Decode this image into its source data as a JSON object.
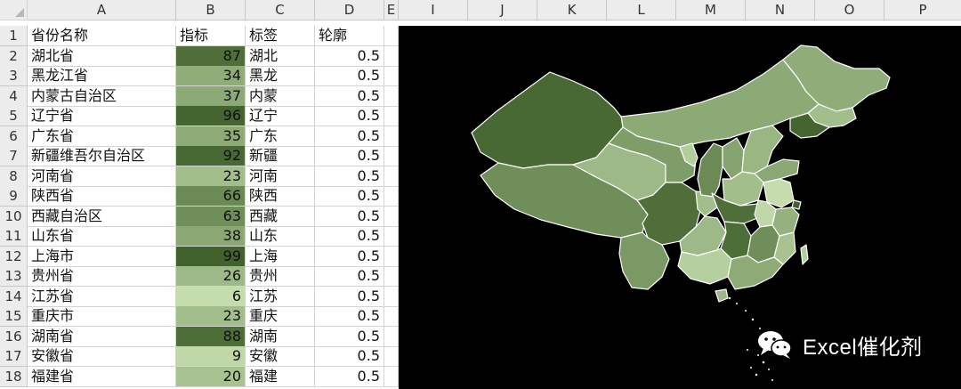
{
  "columns": {
    "row_header_corner": "",
    "letters": [
      "A",
      "B",
      "C",
      "D",
      "E",
      "I",
      "J",
      "K",
      "L",
      "M",
      "N",
      "O",
      "P"
    ]
  },
  "headers": {
    "province_name": "省份名称",
    "indicator": "指标",
    "label": "标签",
    "outline": "轮廓"
  },
  "rows": [
    {
      "num": "2",
      "name": "湖北省",
      "value": "87",
      "tag": "湖北",
      "outline": "0.5",
      "fill": "#4f6e3a"
    },
    {
      "num": "3",
      "name": "黑龙江省",
      "value": "34",
      "tag": "黑龙",
      "outline": "0.5",
      "fill": "#90ad79"
    },
    {
      "num": "4",
      "name": "内蒙古自治区",
      "value": "37",
      "tag": "内蒙",
      "outline": "0.5",
      "fill": "#8caa75"
    },
    {
      "num": "5",
      "name": "辽宁省",
      "value": "96",
      "tag": "辽宁",
      "outline": "0.5",
      "fill": "#446430"
    },
    {
      "num": "6",
      "name": "广东省",
      "value": "35",
      "tag": "广东",
      "outline": "0.5",
      "fill": "#8eab77"
    },
    {
      "num": "7",
      "name": "新疆维吾尔自治区",
      "value": "92",
      "tag": "新疆",
      "outline": "0.5",
      "fill": "#486834"
    },
    {
      "num": "8",
      "name": "河南省",
      "value": "23",
      "tag": "河南",
      "outline": "0.5",
      "fill": "#a2be8b"
    },
    {
      "num": "9",
      "name": "陕西省",
      "value": "66",
      "tag": "陕西",
      "outline": "0.5",
      "fill": "#6b8a55"
    },
    {
      "num": "10",
      "name": "西藏自治区",
      "value": "63",
      "tag": "西藏",
      "outline": "0.5",
      "fill": "#6f8e59"
    },
    {
      "num": "11",
      "name": "山东省",
      "value": "38",
      "tag": "山东",
      "outline": "0.5",
      "fill": "#8ba874"
    },
    {
      "num": "12",
      "name": "上海市",
      "value": "99",
      "tag": "上海",
      "outline": "0.5",
      "fill": "#41612d"
    },
    {
      "num": "13",
      "name": "贵州省",
      "value": "26",
      "tag": "贵州",
      "outline": "0.5",
      "fill": "#9db987"
    },
    {
      "num": "14",
      "name": "江苏省",
      "value": "6",
      "tag": "江苏",
      "outline": "0.5",
      "fill": "#c5dcac"
    },
    {
      "num": "15",
      "name": "重庆市",
      "value": "23",
      "tag": "重庆",
      "outline": "0.5",
      "fill": "#a2be8b"
    },
    {
      "num": "16",
      "name": "湖南省",
      "value": "88",
      "tag": "湖南",
      "outline": "0.5",
      "fill": "#4d6d39"
    },
    {
      "num": "17",
      "name": "安徽省",
      "value": "9",
      "tag": "安徽",
      "outline": "0.5",
      "fill": "#c0d8a7"
    },
    {
      "num": "18",
      "name": "福建省",
      "value": "20",
      "tag": "福建",
      "outline": "0.5",
      "fill": "#a8c391"
    }
  ],
  "header_row_num": "1",
  "map": {
    "background": "#000000",
    "outline_color": "#ffffff"
  },
  "watermark": {
    "text": "Excel催化剂",
    "icon": "wechat-icon"
  }
}
